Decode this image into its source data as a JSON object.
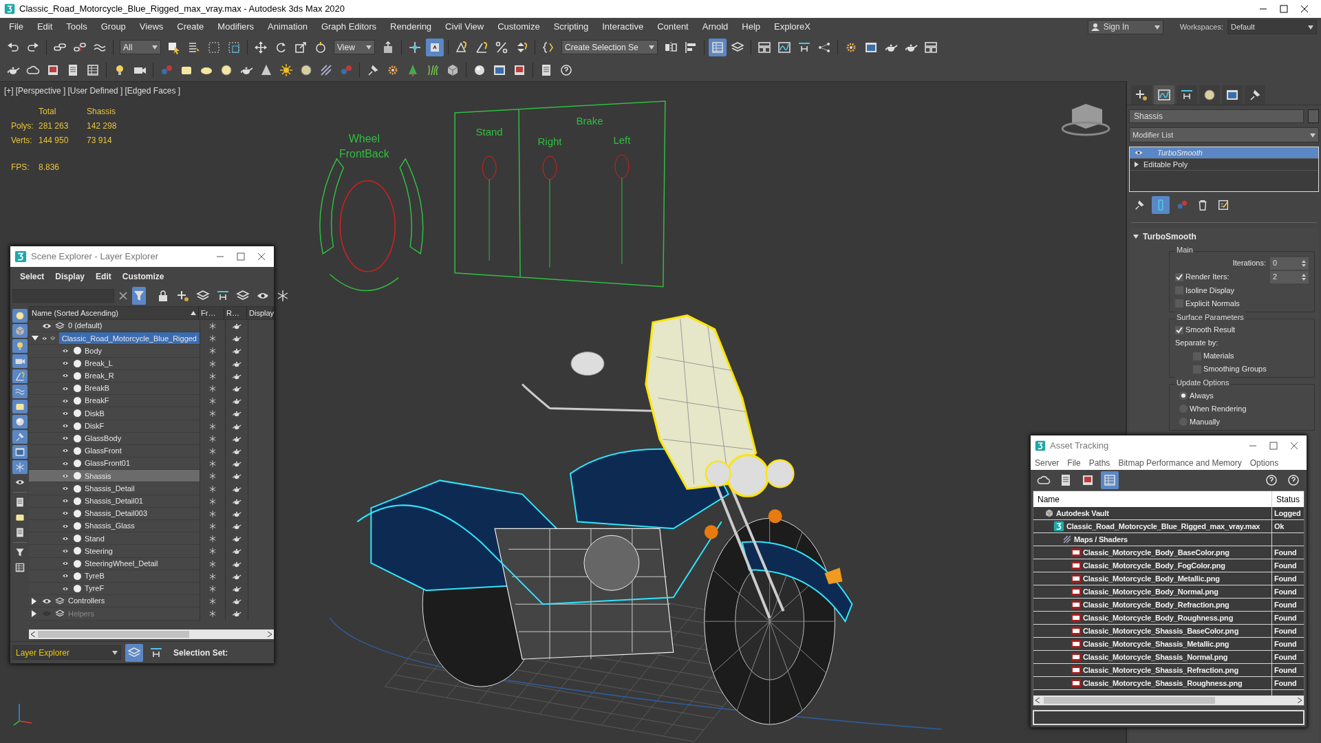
{
  "window": {
    "title": "Classic_Road_Motorcycle_Blue_Rigged_max_vray.max - Autodesk 3ds Max 2020"
  },
  "menu": [
    "File",
    "Edit",
    "Tools",
    "Group",
    "Views",
    "Create",
    "Modifiers",
    "Animation",
    "Graph Editors",
    "Rendering",
    "Civil View",
    "Customize",
    "Scripting",
    "Interactive",
    "Content",
    "Arnold",
    "Help",
    "ExploreX"
  ],
  "account": {
    "sign_in": "Sign In",
    "workspaces_label": "Workspaces:",
    "workspace": "Default"
  },
  "toolbar": {
    "selection_filter": "All",
    "reference_coord": "View",
    "named_selection": "Create Selection Se",
    "keyboard_override_on": true,
    "scene_explorer_toggle_on": true
  },
  "viewport": {
    "labels": [
      "[+]",
      "[Perspective ]",
      "[User Defined ]",
      "[Edged Faces ]"
    ],
    "stats": {
      "headers": [
        "Total",
        "Shassis"
      ],
      "rows": [
        {
          "label": "Polys:",
          "values": [
            "281 263",
            "142 298"
          ]
        },
        {
          "label": "Verts:",
          "values": [
            "144 950",
            "73 914"
          ]
        }
      ],
      "fps_label": "FPS:",
      "fps": "8.836"
    },
    "scene_texts": [
      "Wheel",
      "FrontBack",
      "Stand",
      "Brake",
      "Right",
      "Left"
    ]
  },
  "scene_explorer": {
    "title": "Scene Explorer - Layer Explorer",
    "menu": [
      "Select",
      "Display",
      "Edit",
      "Customize"
    ],
    "filter_toggle_on": true,
    "filters": [
      {
        "on": true
      },
      {
        "on": true
      },
      {
        "on": true
      },
      {
        "on": true
      },
      {
        "on": true
      },
      {
        "on": true
      },
      {
        "on": true
      },
      {
        "on": true
      },
      {
        "on": true
      },
      {
        "on": true
      },
      {
        "on": true
      },
      {
        "on": false
      },
      {
        "on": false
      },
      {
        "on": false
      },
      {
        "on": false
      },
      {
        "on": false
      },
      {
        "on": false
      }
    ],
    "columns": [
      "Name (Sorted Ascending)",
      "Fr…",
      "R…",
      "Display"
    ],
    "layers": [
      {
        "name": "0 (default)",
        "kind": "leaf",
        "visible": true,
        "active": false
      },
      {
        "name": "Classic_Road_Motorcycle_Blue_Rigged",
        "kind": "group",
        "expanded": true,
        "visible": true,
        "active": true,
        "children": [
          {
            "name": "Body",
            "selected": false
          },
          {
            "name": "Break_L",
            "selected": false
          },
          {
            "name": "Break_R",
            "selected": false
          },
          {
            "name": "BreakB",
            "selected": false
          },
          {
            "name": "BreakF",
            "selected": false
          },
          {
            "name": "DiskB",
            "selected": false
          },
          {
            "name": "DiskF",
            "selected": false
          },
          {
            "name": "GlassBody",
            "selected": false
          },
          {
            "name": "GlassFront",
            "selected": false
          },
          {
            "name": "GlassFront01",
            "selected": false
          },
          {
            "name": "Shassis",
            "selected": true
          },
          {
            "name": "Shassis_Detail",
            "selected": false
          },
          {
            "name": "Shassis_Detail01",
            "selected": false
          },
          {
            "name": "Shassis_Detail003",
            "selected": false
          },
          {
            "name": "Shassis_Glass",
            "selected": false
          },
          {
            "name": "Stand",
            "selected": false
          },
          {
            "name": "Steering",
            "selected": false
          },
          {
            "name": "SteeringWheel_Detail",
            "selected": false
          },
          {
            "name": "TyreB",
            "selected": false
          },
          {
            "name": "TyreF",
            "selected": false
          }
        ]
      },
      {
        "name": "Controllers",
        "kind": "group",
        "expanded": false,
        "visible": true,
        "active": false
      },
      {
        "name": "Helpers",
        "kind": "group",
        "expanded": false,
        "visible": false,
        "active": false
      }
    ],
    "mode": "Layer Explorer",
    "selection_set_label": "Selection Set:"
  },
  "command_panel": {
    "tabs": [
      {
        "selected": false
      },
      {
        "selected": true
      },
      {
        "selected": false
      },
      {
        "selected": false
      },
      {
        "selected": false
      },
      {
        "selected": false
      }
    ],
    "object_name": "Shassis",
    "modifier_list": "Modifier List",
    "stack": [
      {
        "name": "TurboSmooth",
        "kind": "modifier",
        "selected": true
      },
      {
        "name": "Editable Poly",
        "kind": "base",
        "selected": false
      }
    ],
    "stack_tools": [
      {
        "selected": false
      },
      {
        "selected": true
      },
      {
        "selected": false
      },
      {
        "selected": false
      },
      {
        "selected": false
      }
    ],
    "rollout": {
      "title": "TurboSmooth",
      "expanded": true,
      "groups": [
        {
          "title": "Main",
          "controls": [
            {
              "kind": "spinner",
              "label": "Iterations:",
              "value": "0"
            },
            {
              "kind": "check-spinner",
              "label": "Render Iters:",
              "checked": true,
              "value": "2"
            },
            {
              "kind": "checkbox",
              "label": "Isoline Display",
              "checked": false
            },
            {
              "kind": "checkbox",
              "label": "Explicit Normals",
              "checked": false
            }
          ]
        },
        {
          "title": "Surface Parameters",
          "controls": [
            {
              "kind": "checkbox",
              "label": "Smooth Result",
              "checked": true
            },
            {
              "kind": "text",
              "label": "Separate by:"
            },
            {
              "kind": "sub-checkbox",
              "label": "Materials",
              "checked": false
            },
            {
              "kind": "sub-checkbox",
              "label": "Smoothing Groups",
              "checked": false
            }
          ]
        },
        {
          "title": "Update Options",
          "controls": [
            {
              "kind": "radio",
              "label": "Always",
              "selected": true
            },
            {
              "kind": "radio",
              "label": "When Rendering",
              "selected": false
            },
            {
              "kind": "radio",
              "label": "Manually",
              "selected": false
            }
          ]
        }
      ]
    }
  },
  "asset_tracking": {
    "title": "Asset Tracking",
    "menu": [
      "Server",
      "File",
      "Paths",
      "Bitmap Performance and Memory",
      "Options"
    ],
    "tools": [
      {
        "selected": false
      },
      {
        "selected": false
      },
      {
        "selected": false
      },
      {
        "selected": true
      }
    ],
    "columns": [
      "Name",
      "Status"
    ],
    "rows": [
      {
        "name": "Autodesk Vault",
        "status": "Logged",
        "kind": "vault",
        "children": [
          {
            "name": "Classic_Road_Motorcycle_Blue_Rigged_max_vray.max",
            "status": "Ok",
            "kind": "scene",
            "children": [
              {
                "name": "Maps / Shaders",
                "kind": "folder",
                "children": [
                  {
                    "name": "Classic_Motorcycle_Body_BaseColor.png",
                    "status": "Found",
                    "kind": "png"
                  },
                  {
                    "name": "Classic_Motorcycle_Body_FogColor.png",
                    "status": "Found",
                    "kind": "png"
                  },
                  {
                    "name": "Classic_Motorcycle_Body_Metallic.png",
                    "status": "Found",
                    "kind": "png"
                  },
                  {
                    "name": "Classic_Motorcycle_Body_Normal.png",
                    "status": "Found",
                    "kind": "png"
                  },
                  {
                    "name": "Classic_Motorcycle_Body_Refraction.png",
                    "status": "Found",
                    "kind": "png"
                  },
                  {
                    "name": "Classic_Motorcycle_Body_Roughness.png",
                    "status": "Found",
                    "kind": "png"
                  },
                  {
                    "name": "Classic_Motorcycle_Shassis_BaseColor.png",
                    "status": "Found",
                    "kind": "png"
                  },
                  {
                    "name": "Classic_Motorcycle_Shassis_Metallic.png",
                    "status": "Found",
                    "kind": "png"
                  },
                  {
                    "name": "Classic_Motorcycle_Shassis_Normal.png",
                    "status": "Found",
                    "kind": "png"
                  },
                  {
                    "name": "Classic_Motorcycle_Shassis_Refraction.png",
                    "status": "Found",
                    "kind": "png"
                  },
                  {
                    "name": "Classic_Motorcycle_Shassis_Roughness.png",
                    "status": "Found",
                    "kind": "png"
                  }
                ]
              }
            ]
          }
        ]
      }
    ]
  }
}
